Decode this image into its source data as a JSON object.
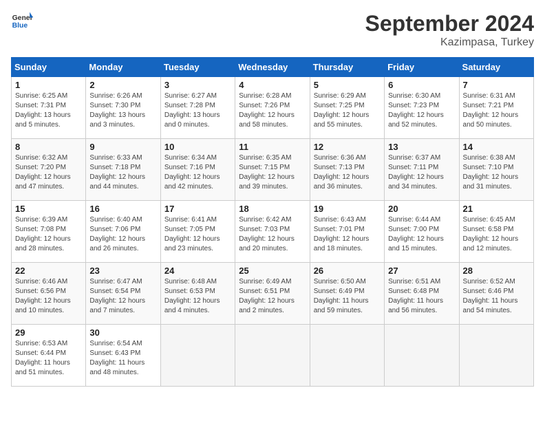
{
  "header": {
    "logo_line1": "General",
    "logo_line2": "Blue",
    "month": "September 2024",
    "location": "Kazimpasa, Turkey"
  },
  "weekdays": [
    "Sunday",
    "Monday",
    "Tuesday",
    "Wednesday",
    "Thursday",
    "Friday",
    "Saturday"
  ],
  "weeks": [
    [
      {
        "day": "1",
        "sunrise": "6:25 AM",
        "sunset": "7:31 PM",
        "daylight": "13 hours and 5 minutes."
      },
      {
        "day": "2",
        "sunrise": "6:26 AM",
        "sunset": "7:30 PM",
        "daylight": "13 hours and 3 minutes."
      },
      {
        "day": "3",
        "sunrise": "6:27 AM",
        "sunset": "7:28 PM",
        "daylight": "13 hours and 0 minutes."
      },
      {
        "day": "4",
        "sunrise": "6:28 AM",
        "sunset": "7:26 PM",
        "daylight": "12 hours and 58 minutes."
      },
      {
        "day": "5",
        "sunrise": "6:29 AM",
        "sunset": "7:25 PM",
        "daylight": "12 hours and 55 minutes."
      },
      {
        "day": "6",
        "sunrise": "6:30 AM",
        "sunset": "7:23 PM",
        "daylight": "12 hours and 52 minutes."
      },
      {
        "day": "7",
        "sunrise": "6:31 AM",
        "sunset": "7:21 PM",
        "daylight": "12 hours and 50 minutes."
      }
    ],
    [
      {
        "day": "8",
        "sunrise": "6:32 AM",
        "sunset": "7:20 PM",
        "daylight": "12 hours and 47 minutes."
      },
      {
        "day": "9",
        "sunrise": "6:33 AM",
        "sunset": "7:18 PM",
        "daylight": "12 hours and 44 minutes."
      },
      {
        "day": "10",
        "sunrise": "6:34 AM",
        "sunset": "7:16 PM",
        "daylight": "12 hours and 42 minutes."
      },
      {
        "day": "11",
        "sunrise": "6:35 AM",
        "sunset": "7:15 PM",
        "daylight": "12 hours and 39 minutes."
      },
      {
        "day": "12",
        "sunrise": "6:36 AM",
        "sunset": "7:13 PM",
        "daylight": "12 hours and 36 minutes."
      },
      {
        "day": "13",
        "sunrise": "6:37 AM",
        "sunset": "7:11 PM",
        "daylight": "12 hours and 34 minutes."
      },
      {
        "day": "14",
        "sunrise": "6:38 AM",
        "sunset": "7:10 PM",
        "daylight": "12 hours and 31 minutes."
      }
    ],
    [
      {
        "day": "15",
        "sunrise": "6:39 AM",
        "sunset": "7:08 PM",
        "daylight": "12 hours and 28 minutes."
      },
      {
        "day": "16",
        "sunrise": "6:40 AM",
        "sunset": "7:06 PM",
        "daylight": "12 hours and 26 minutes."
      },
      {
        "day": "17",
        "sunrise": "6:41 AM",
        "sunset": "7:05 PM",
        "daylight": "12 hours and 23 minutes."
      },
      {
        "day": "18",
        "sunrise": "6:42 AM",
        "sunset": "7:03 PM",
        "daylight": "12 hours and 20 minutes."
      },
      {
        "day": "19",
        "sunrise": "6:43 AM",
        "sunset": "7:01 PM",
        "daylight": "12 hours and 18 minutes."
      },
      {
        "day": "20",
        "sunrise": "6:44 AM",
        "sunset": "7:00 PM",
        "daylight": "12 hours and 15 minutes."
      },
      {
        "day": "21",
        "sunrise": "6:45 AM",
        "sunset": "6:58 PM",
        "daylight": "12 hours and 12 minutes."
      }
    ],
    [
      {
        "day": "22",
        "sunrise": "6:46 AM",
        "sunset": "6:56 PM",
        "daylight": "12 hours and 10 minutes."
      },
      {
        "day": "23",
        "sunrise": "6:47 AM",
        "sunset": "6:54 PM",
        "daylight": "12 hours and 7 minutes."
      },
      {
        "day": "24",
        "sunrise": "6:48 AM",
        "sunset": "6:53 PM",
        "daylight": "12 hours and 4 minutes."
      },
      {
        "day": "25",
        "sunrise": "6:49 AM",
        "sunset": "6:51 PM",
        "daylight": "12 hours and 2 minutes."
      },
      {
        "day": "26",
        "sunrise": "6:50 AM",
        "sunset": "6:49 PM",
        "daylight": "11 hours and 59 minutes."
      },
      {
        "day": "27",
        "sunrise": "6:51 AM",
        "sunset": "6:48 PM",
        "daylight": "11 hours and 56 minutes."
      },
      {
        "day": "28",
        "sunrise": "6:52 AM",
        "sunset": "6:46 PM",
        "daylight": "11 hours and 54 minutes."
      }
    ],
    [
      {
        "day": "29",
        "sunrise": "6:53 AM",
        "sunset": "6:44 PM",
        "daylight": "11 hours and 51 minutes."
      },
      {
        "day": "30",
        "sunrise": "6:54 AM",
        "sunset": "6:43 PM",
        "daylight": "11 hours and 48 minutes."
      },
      null,
      null,
      null,
      null,
      null
    ]
  ]
}
